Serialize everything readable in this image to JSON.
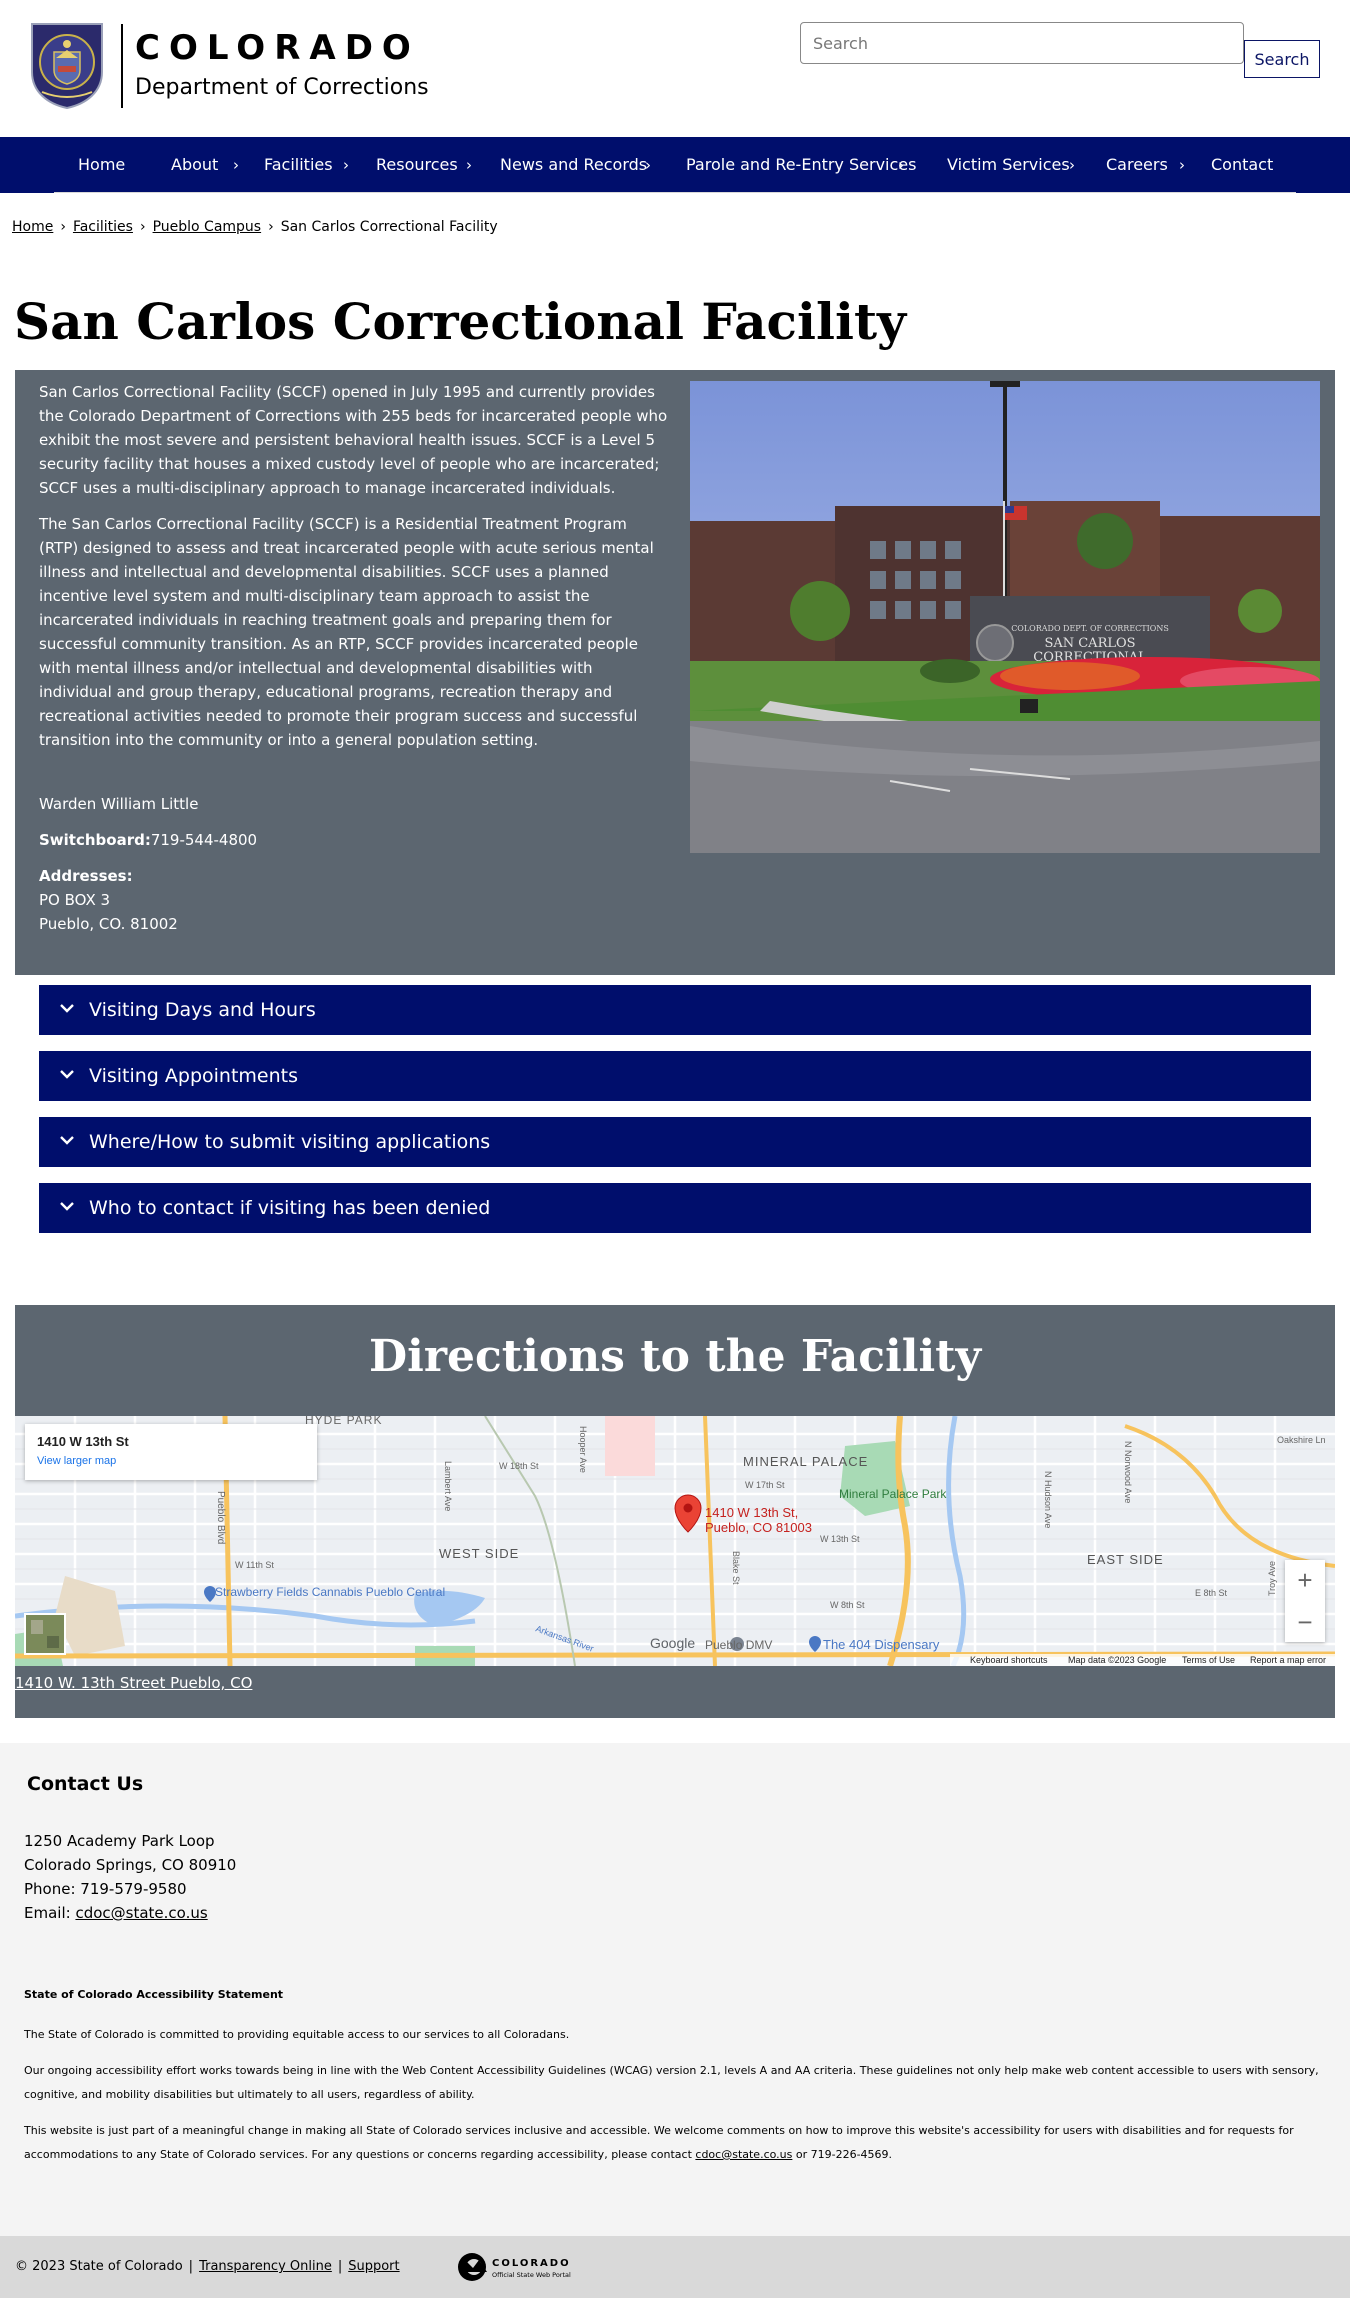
{
  "header": {
    "brand_title": "COLORADO",
    "brand_subtitle": "Department of Corrections",
    "search_placeholder": "Search",
    "search_button": "Search"
  },
  "nav": {
    "items": [
      {
        "label": "Home"
      },
      {
        "label": "About"
      },
      {
        "label": "Facilities"
      },
      {
        "label": "Resources"
      },
      {
        "label": "News and Records"
      },
      {
        "label": "Parole and Re-Entry Services"
      },
      {
        "label": "Victim Services"
      },
      {
        "label": "Careers"
      },
      {
        "label": "Contact"
      }
    ],
    "chevron": "›"
  },
  "breadcrumb": {
    "items": [
      "Home",
      "Facilities",
      "Pueblo Campus"
    ],
    "current": "San Carlos Correctional Facility",
    "separator": "›"
  },
  "page": {
    "title": "San Carlos Correctional Facility"
  },
  "info": {
    "paragraph1": "San Carlos Correctional Facility (SCCF) opened in July 1995 and currently provides the Colorado Department of Corrections with 255 beds for incarcerated people who exhibit the most severe and persistent behavioral health issues.  SCCF is a Level 5 security facility that houses a mixed custody level of people who are incarcerated; SCCF uses a multi-disciplinary approach to manage incarcerated individuals.",
    "paragraph2": "The San Carlos Correctional Facility (SCCF) is a Residential Treatment Program (RTP) designed to assess and treat incarcerated people with acute serious mental illness and intellectual and developmental disabilities.  SCCF uses a planned incentive level system and multi-disciplinary team approach to assist the incarcerated individuals in reaching treatment goals and preparing them for successful community transition.  As an RTP, SCCF provides incarcerated people with mental illness and/or intellectual and developmental disabilities with individual and group therapy, educational programs, recreation therapy and recreational activities needed to promote their program success and successful transition into the community or into a general population setting.",
    "warden": "Warden William Little",
    "switchboard_label": "Switchboard:",
    "switchboard_value": "719-544-4800",
    "addresses_label": "Addresses:",
    "address_line1": "PO BOX 3",
    "address_line2": "Pueblo, CO. 81002",
    "photo_sign_line1": "COLORADO DEPT. OF CORRECTIONS",
    "photo_sign_line2": "SAN CARLOS",
    "photo_sign_line3": "CORRECTIONAL"
  },
  "accordion": [
    {
      "label": "Visiting Days and Hours"
    },
    {
      "label": "Visiting Appointments"
    },
    {
      "label": "Where/How to submit visiting applications"
    },
    {
      "label": "Who to contact if visiting has been denied"
    }
  ],
  "directions": {
    "title": "Directions to the Facility",
    "map_card_title": "1410 W 13th St",
    "map_card_link": "View larger map",
    "pin_label_line1": "1410 W 13th St,",
    "pin_label_line2": "Pueblo, CO 81003",
    "address_link": "1410 W. 13th Street Pueblo, CO",
    "map_labels": {
      "hyde_park": "HYDE PARK",
      "mineral_palace": "MINERAL PALACE",
      "mineral_palace_park": "Mineral Palace Park",
      "west_side": "WEST SIDE",
      "east_side": "EAST SIDE",
      "strawberry_fields": "Strawberry Fields Cannabis Pueblo Central",
      "dispensary": "The 404 Dispensary",
      "dmv": "Pueblo DMV",
      "pueblo_blvd": "Pueblo Blvd",
      "w18th": "W 18th St",
      "w17th": "W 17th St",
      "w13th": "W 13th St",
      "w11th": "W 11th St",
      "w8th": "W 8th St",
      "e8th": "E 8th St",
      "oakshire": "Oakshire Ln",
      "hudson": "N Hudson Ave",
      "norwood": "N Norwood Ave",
      "troy": "Troy Ave",
      "lambert": "Lambert Ave",
      "hooper": "Hooper Ave",
      "blake": "Blake St",
      "arkansas": "Arkansas River",
      "google": "Google"
    },
    "zoom_in": "+",
    "zoom_out": "−",
    "map_footer": {
      "shortcuts": "Keyboard shortcuts",
      "data": "Map data ©2023 Google",
      "terms": "Terms of Use",
      "report": "Report a map error"
    }
  },
  "contact": {
    "heading": "Contact Us",
    "line1": "1250 Academy Park Loop",
    "line2": "Colorado Springs, CO 80910",
    "phone": "Phone: 719-579-9580",
    "email_label": "Email: ",
    "email": "cdoc@state.co.us"
  },
  "accessibility": {
    "heading": "State of Colorado Accessibility Statement",
    "p1": "The State of Colorado is committed to providing equitable access to our services to all Coloradans.",
    "p2": "Our ongoing accessibility effort works towards being in line with the Web Content Accessibility Guidelines (WCAG) version 2.1, levels A and AA criteria. These guidelines not only help make web content accessible to users with sensory, cognitive, and mobility disabilities but ultimately to all users, regardless of ability.",
    "p3_before": "This website is just part of a meaningful change in making all State of Colorado services inclusive and accessible. We welcome comments on how to improve this website's accessibility for users with disabilities and for requests for accommodations to any State of Colorado services. For any questions or concerns regarding accessibility, please contact ",
    "p3_email": "cdoc@state.co.us",
    "p3_after": " or 719-226-4569."
  },
  "footer": {
    "copyright": "© 2023 State of Colorado",
    "transparency": "Transparency Online",
    "support": "Support",
    "separator": "|",
    "logo_title": "COLORADO",
    "logo_subtitle": "Official State Web Portal"
  },
  "colors": {
    "navy": "#000e6c",
    "slate": "#5c6670",
    "footer_bg": "#f4f4f4",
    "bottom_bar": "#d9d9d9"
  }
}
